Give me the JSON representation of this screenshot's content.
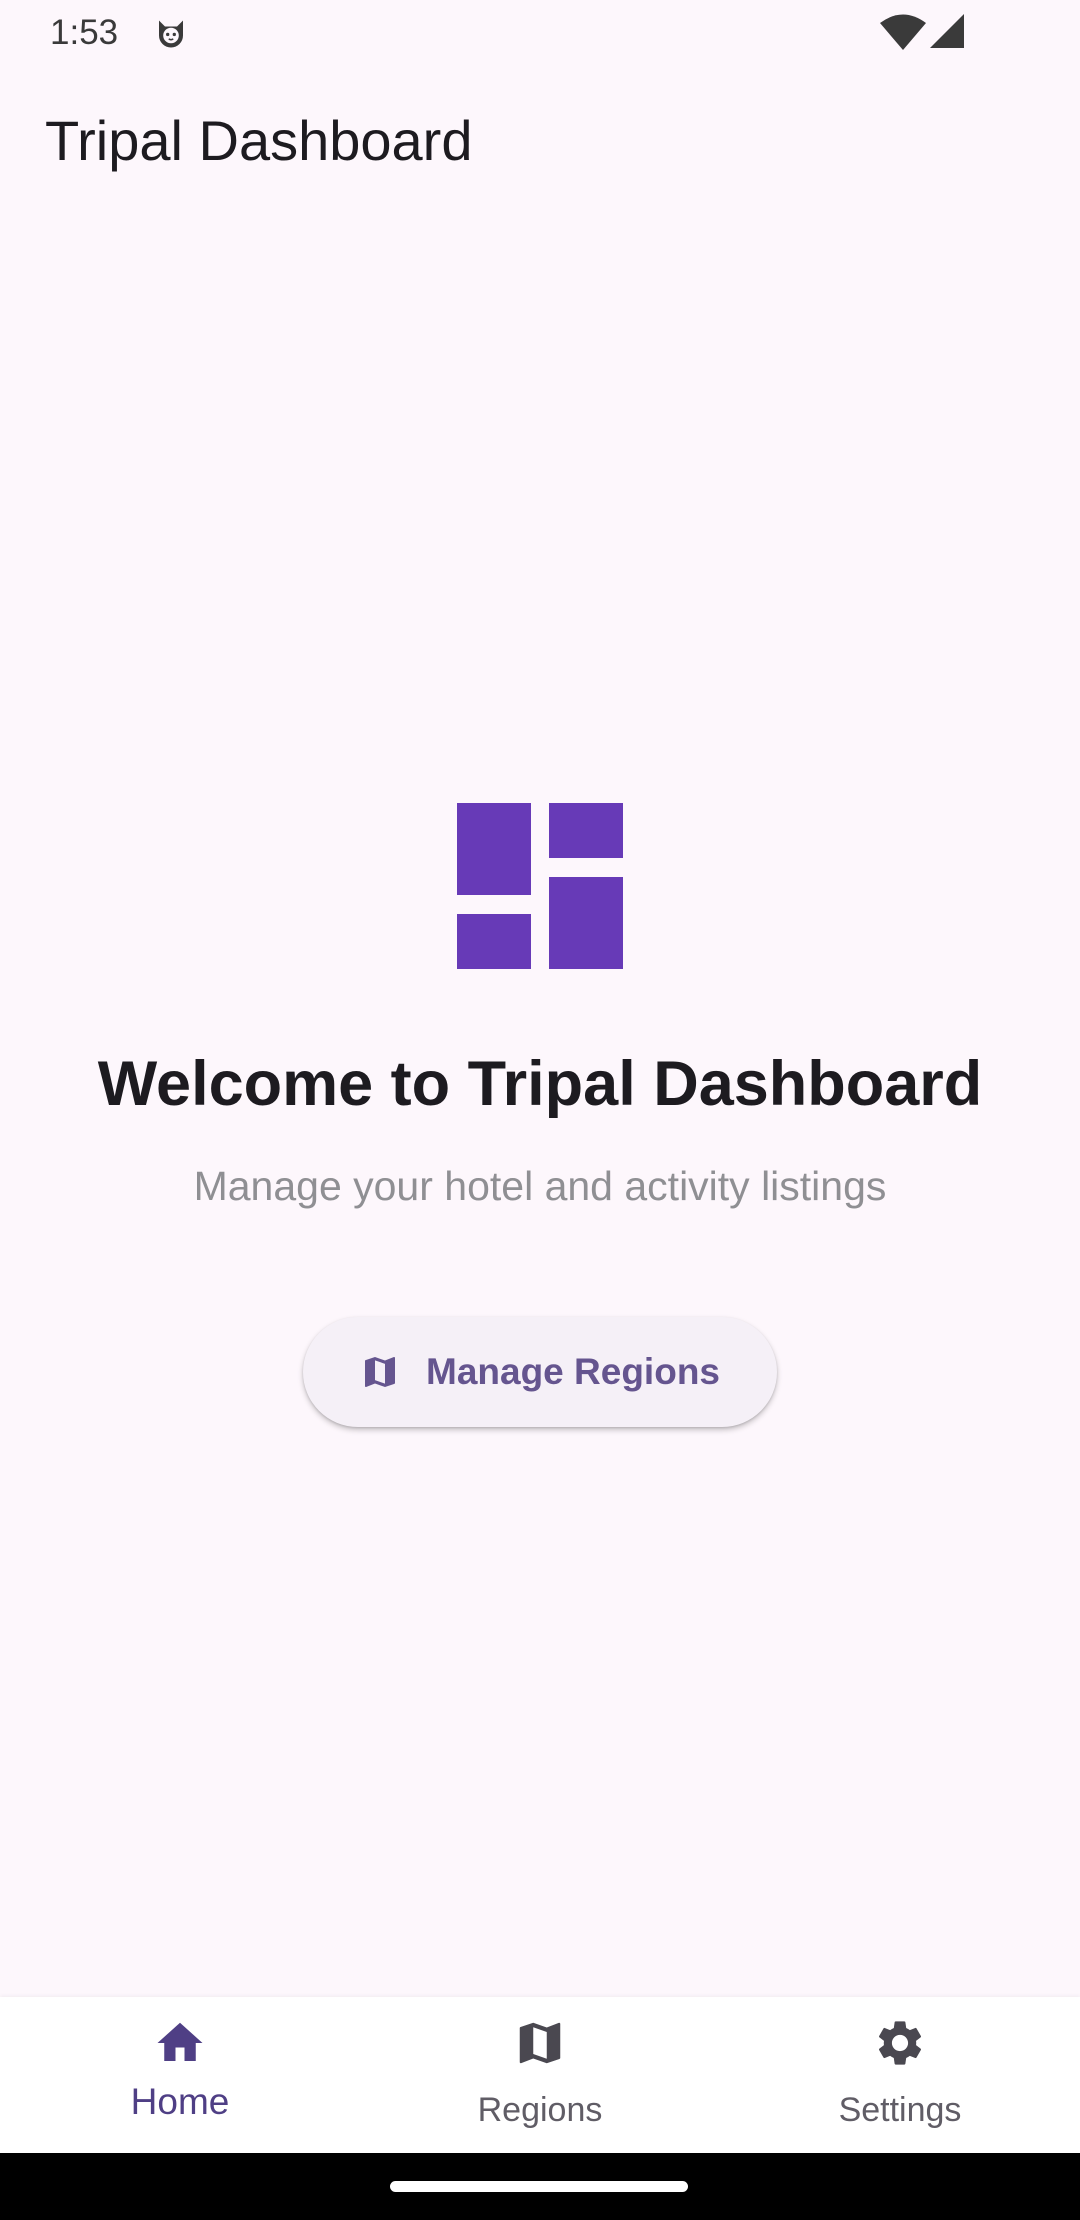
{
  "status_bar": {
    "time": "1:53",
    "icons": [
      "cat-face-icon",
      "wifi-icon",
      "cell-signal-icon"
    ]
  },
  "app_bar": {
    "title": "Tripal Dashboard"
  },
  "main": {
    "logo_icon": "dashboard-icon",
    "welcome_title": "Welcome to Tripal Dashboard",
    "welcome_subtitle": "Manage your hotel and activity listings",
    "manage_button": {
      "icon": "map-icon",
      "label": "Manage Regions"
    }
  },
  "bottom_nav": {
    "items": [
      {
        "label": "Home",
        "icon": "home-icon",
        "active": true
      },
      {
        "label": "Regions",
        "icon": "map-icon",
        "active": false
      },
      {
        "label": "Settings",
        "icon": "gear-icon",
        "active": false
      }
    ]
  },
  "colors": {
    "background": "#FDF7FC",
    "accent": "#673AB7",
    "primary_text": "#1D1B20",
    "button_label": "#65558F",
    "nav_active": "#4F3F85",
    "nav_inactive": "#605D66"
  }
}
